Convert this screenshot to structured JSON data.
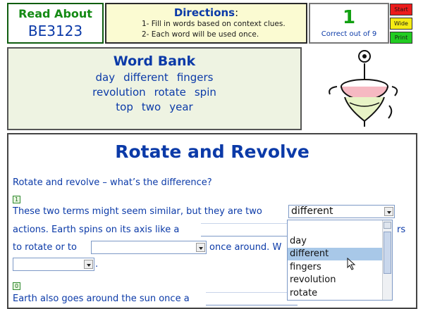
{
  "header": {
    "read_about_label": "Read About",
    "code": "BE3123",
    "directions_title": "Directions",
    "directions_colon": ":",
    "direction_1": "1- Fill in words based on context clues.",
    "direction_2": "2- Each word will be used once.",
    "score_value": "1",
    "score_label": "Correct out of 9",
    "buttons": {
      "start": "Start",
      "wide": "Wide",
      "print": "Print"
    }
  },
  "word_bank": {
    "title": "Word Bank",
    "rows": [
      [
        "day",
        "different",
        "fingers"
      ],
      [
        "revolution",
        "rotate",
        "spin"
      ],
      [
        "top",
        "two",
        "year"
      ]
    ]
  },
  "article": {
    "title": "Rotate and Revolve",
    "intro": "Rotate and revolve – what’s the difference?",
    "para1_num": "1",
    "p1_line1": "These two terms might seem similar, but they are two",
    "p1_line2a": "actions.  Earth spins on its axis like a",
    "p1_line2b": "rs",
    "p1_line3a": "to rotate or to",
    "p1_line3b": "once around.  W",
    "p1_line4": ".",
    "para2_num": "0",
    "p2_line1": "Earth also goes around the sun once a",
    "blank1_value": "different"
  },
  "dropdown": {
    "options": [
      "day",
      "different",
      "fingers",
      "revolution",
      "rotate"
    ],
    "selected": "different"
  },
  "colors": {
    "accent_blue": "#0b3aa8",
    "green": "#138a13",
    "start": "#ec1c1c",
    "wide": "#f5ec14",
    "print": "#22cc22"
  }
}
